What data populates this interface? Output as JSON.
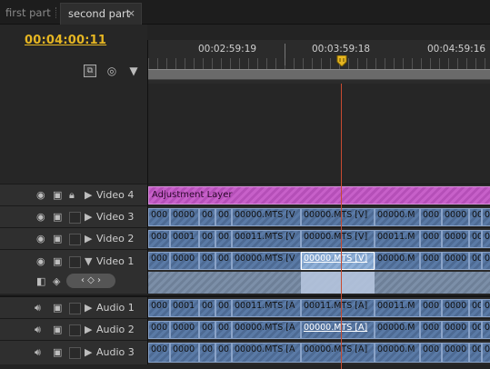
{
  "tabs": [
    {
      "label": "first part"
    },
    {
      "label": "second part",
      "close": "×"
    }
  ],
  "timecode": "00:04:00:11",
  "ruler": {
    "times": [
      "00:02:59:19",
      "00:03:59:18",
      "00:04:59:16"
    ]
  },
  "tracks": {
    "video4": {
      "name": "Video 4",
      "clip": "Adjustment Layer"
    },
    "video3": {
      "name": "Video 3",
      "clips": [
        "000",
        "0000",
        "00",
        "00",
        "00000.MTS [V",
        "00000.MTS [V]",
        "00000.M",
        "000",
        "0000",
        "00",
        "00"
      ]
    },
    "video2": {
      "name": "Video 2",
      "clips": [
        "000",
        "0001",
        "00",
        "00",
        "00011.MTS [V",
        "00000.MTS [V]",
        "00011.M",
        "000",
        "0000",
        "00",
        "00"
      ]
    },
    "video1": {
      "name": "Video 1",
      "clips": [
        "000",
        "0000",
        "00",
        "00",
        "00000.MTS [V",
        "00000.MTS [V]",
        "00000.M",
        "000",
        "0000",
        "00",
        "00"
      ]
    },
    "audio1": {
      "name": "Audio 1",
      "clips": [
        "000",
        "0001",
        "00",
        "00",
        "00011.MTS [A",
        "00011.MTS [A]",
        "00011.M",
        "000",
        "0000",
        "00",
        "00"
      ]
    },
    "audio2": {
      "name": "Audio 2",
      "clips": [
        "000",
        "0000",
        "00",
        "00",
        "00000.MTS [A",
        "00000.MTS [A]",
        "00000.M",
        "000",
        "0000",
        "00",
        "00"
      ]
    },
    "audio3": {
      "name": "Audio 3",
      "clips": [
        "000",
        "0000",
        "00",
        "00",
        "00000.MTS [A",
        "00000.MTS [A]",
        "00000.M",
        "000",
        "0000",
        "00",
        "00"
      ]
    }
  },
  "colors": {
    "timecode": "#e6b622",
    "clip": "#5a7aa6",
    "adjustment": "#c760c9",
    "playhead": "#c84b30"
  }
}
